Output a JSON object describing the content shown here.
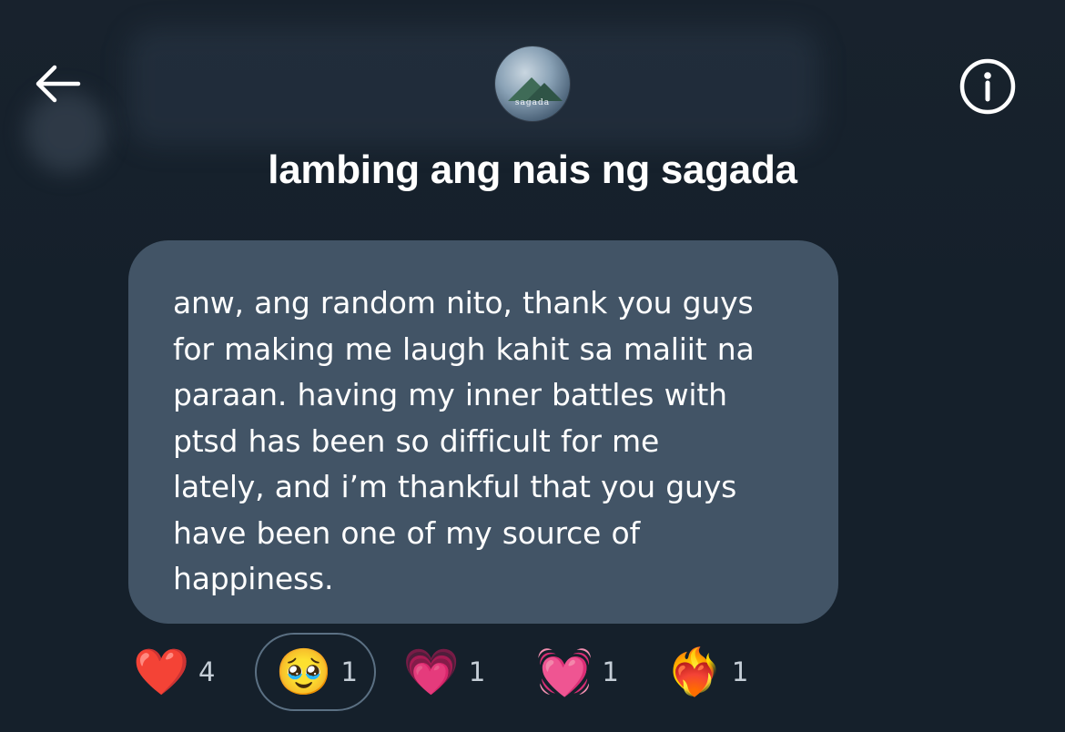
{
  "header": {
    "title": "lambing ang nais ng sagada",
    "avatar_text": "sagada",
    "back_icon": "arrow-left-icon",
    "info_icon": "info-icon"
  },
  "message": {
    "lines": [
      "anw, ang random nito, thank you guys",
      "for making me laugh kahit sa maliit na",
      "paraan. having my inner battles with",
      "ptsd has been so difficult for me",
      "lately, and i’m thankful that you guys",
      "have been one of my source of",
      "happiness."
    ]
  },
  "reactions": [
    {
      "emoji": "❤️",
      "name": "red-heart",
      "count": "4",
      "selected": false
    },
    {
      "emoji": "🥹",
      "name": "face-holding-back-tears",
      "count": "1",
      "selected": true
    },
    {
      "emoji": "💗",
      "name": "growing-heart",
      "count": "1",
      "selected": false
    },
    {
      "emoji": "💓",
      "name": "beating-heart",
      "count": "1",
      "selected": false
    },
    {
      "emoji": "❤️‍🔥",
      "name": "heart-on-fire",
      "count": "1",
      "selected": false
    }
  ],
  "colors": {
    "background": "#15202b",
    "bubble": "#425466",
    "text": "#ffffff",
    "count": "#c5ced7",
    "selected_border": "#5b7083"
  }
}
